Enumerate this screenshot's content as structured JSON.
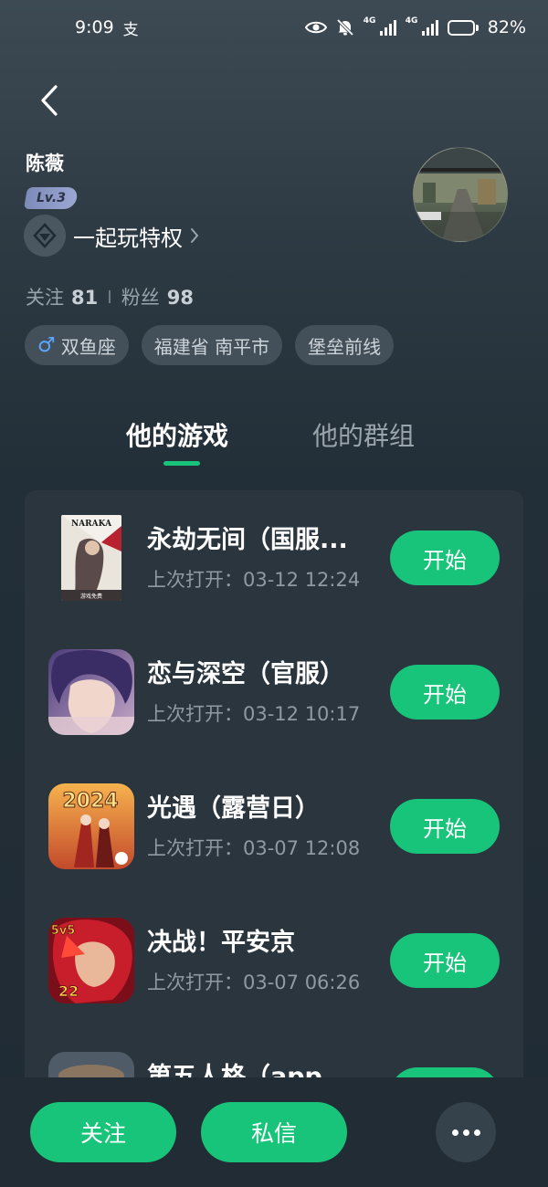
{
  "status_bar": {
    "time": "9:09",
    "notification_glyph": "支",
    "network_tag_1": "4G",
    "network_tag_2": "4G",
    "battery_text": "82%",
    "battery_level": 0.82
  },
  "profile": {
    "name": "陈薇",
    "level": "Lv.3",
    "privilege_label": "一起玩特权",
    "following_label": "关注",
    "following_count": "81",
    "fans_label": "粉丝",
    "fans_count": "98",
    "tags": [
      "双鱼座",
      "福建省 南平市",
      "堡垒前线"
    ]
  },
  "tabs": {
    "games": "他的游戏",
    "groups": "他的群组",
    "active": "games"
  },
  "games": [
    {
      "title": "永劫无间（国服...",
      "last_opened": "上次打开：03-12 12:24",
      "action": "开始",
      "icon_text": "NARAKA",
      "icon_caption": "游戏免费"
    },
    {
      "title": "恋与深空（官服）",
      "last_opened": "上次打开：03-12 10:17",
      "action": "开始"
    },
    {
      "title": "光遇（露营日）",
      "last_opened": "上次打开：03-07 12:08",
      "action": "开始",
      "icon_text": "2024"
    },
    {
      "title": "决战！平安京",
      "last_opened": "上次打开：03-07 06:26",
      "action": "开始",
      "icon_text": "5v5",
      "icon_text_2": "22"
    },
    {
      "title": "第五人格（app...",
      "last_opened": "",
      "action": "开始"
    }
  ],
  "bottom_bar": {
    "follow": "关注",
    "message": "私信"
  },
  "colors": {
    "accent": "#17c47a",
    "panel": "#2a353e",
    "chip": "#434f59",
    "gender_male": "#5ba6ff"
  }
}
